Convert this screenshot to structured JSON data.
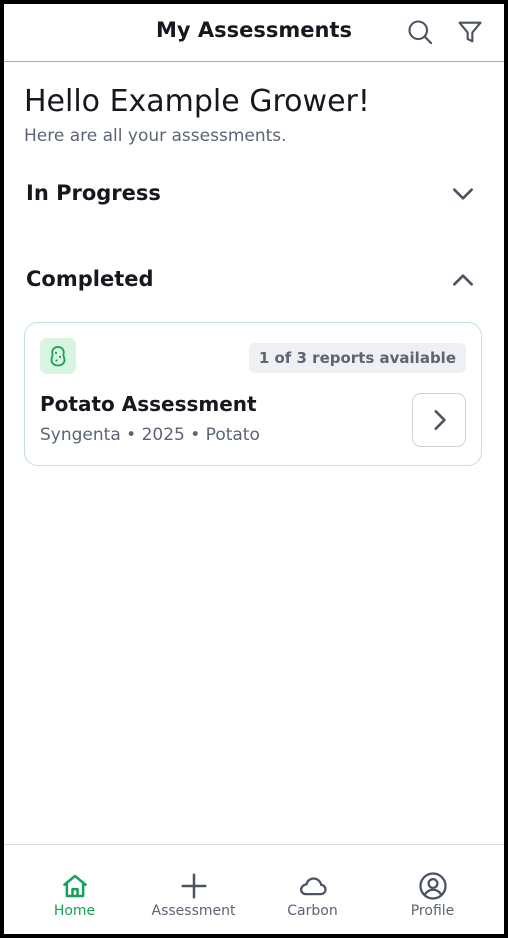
{
  "header": {
    "title": "My Assessments",
    "search_icon": "search-icon",
    "filter_icon": "filter-icon"
  },
  "greeting": {
    "title": "Hello Example Grower!",
    "subtitle": "Here are all your assessments."
  },
  "sections": {
    "in_progress": {
      "label": "In Progress",
      "expanded": false
    },
    "completed": {
      "label": "Completed",
      "expanded": true
    }
  },
  "assessments": [
    {
      "crop_icon": "potato-icon",
      "reports_badge": "1 of 3 reports available",
      "title": "Potato Assessment",
      "meta": "Syngenta • 2025 • Potato"
    }
  ],
  "bottom_nav": {
    "active": "Home",
    "items": [
      {
        "label": "Home",
        "icon": "home-icon"
      },
      {
        "label": "Assessment",
        "icon": "plus-icon"
      },
      {
        "label": "Carbon",
        "icon": "cloud-icon"
      },
      {
        "label": "Profile",
        "icon": "user-circle-icon"
      }
    ]
  },
  "colors": {
    "accent": "#15a15a",
    "badge_bg": "#d7f5e1",
    "card_border": "#bfe3cf",
    "text_primary": "#15181f",
    "text_secondary": "#5b6475"
  }
}
